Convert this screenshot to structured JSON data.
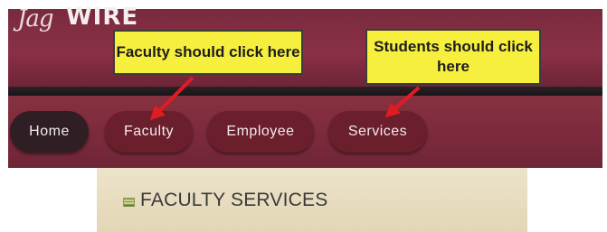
{
  "brand": {
    "logo_script": "Jag",
    "logo_word": "WIRE"
  },
  "nav": {
    "home": "Home",
    "faculty": "Faculty",
    "employee": "Employee",
    "services": "Services"
  },
  "callouts": {
    "faculty": "Faculty should click here",
    "students": "Students should click here"
  },
  "section": {
    "title": "FACULTY SERVICES"
  },
  "colors": {
    "banner": "#7a2a3e",
    "nav_button": "#6b1f2d",
    "home_button": "#2f1f25",
    "callout": "#f7ef3e",
    "arrow": "#e11b22",
    "section_bg": "#e6dabb"
  }
}
